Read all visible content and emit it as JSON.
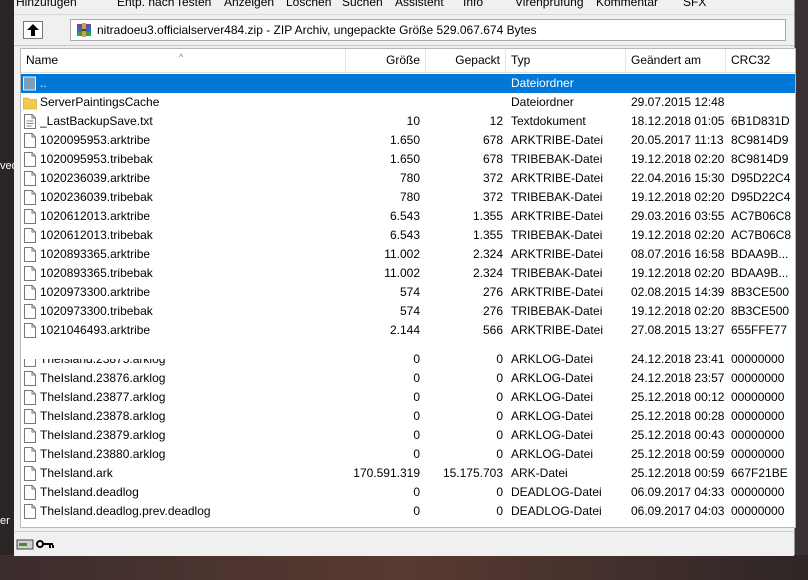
{
  "desktop": {
    "left_text_1": "ved",
    "left_text_2": "er"
  },
  "toolbar": {
    "items": [
      "Hinzufügen",
      "Entp. nach",
      "Testen",
      "Anzeigen",
      "Löschen",
      "Suchen",
      "Assistent",
      "Info",
      "Virenprüfung",
      "Kommentar",
      "SFX"
    ]
  },
  "address": {
    "text": "nitradoeu3.officialserver484.zip - ZIP Archiv, ungepackte Größe 529.067.674 Bytes"
  },
  "columns": {
    "name": "Name",
    "size": "Größe",
    "packed": "Gepackt",
    "type": "Typ",
    "modified": "Geändert am",
    "crc": "CRC32"
  },
  "files": [
    {
      "name": "..",
      "size": "",
      "packed": "",
      "type": "Dateiordner",
      "modified": "",
      "crc": "",
      "icon": "folder-up-icon"
    },
    {
      "name": "ServerPaintingsCache",
      "size": "",
      "packed": "",
      "type": "Dateiordner",
      "modified": "29.07.2015 12:48",
      "crc": "",
      "icon": "folder-icon"
    },
    {
      "name": "_LastBackupSave.txt",
      "size": "10",
      "packed": "12",
      "type": "Textdokument",
      "modified": "18.12.2018 01:05",
      "crc": "6B1D831D",
      "icon": "text-file-icon"
    },
    {
      "name": "1020095953.arktribe",
      "size": "1.650",
      "packed": "678",
      "type": "ARKTRIBE-Datei",
      "modified": "20.05.2017 11:13",
      "crc": "8C9814D9",
      "icon": "file-icon"
    },
    {
      "name": "1020095953.tribebak",
      "size": "1.650",
      "packed": "678",
      "type": "TRIBEBAK-Datei",
      "modified": "19.12.2018 02:20",
      "crc": "8C9814D9",
      "icon": "file-icon"
    },
    {
      "name": "1020236039.arktribe",
      "size": "780",
      "packed": "372",
      "type": "ARKTRIBE-Datei",
      "modified": "22.04.2016 15:30",
      "crc": "D95D22C4",
      "icon": "file-icon"
    },
    {
      "name": "1020236039.tribebak",
      "size": "780",
      "packed": "372",
      "type": "TRIBEBAK-Datei",
      "modified": "19.12.2018 02:20",
      "crc": "D95D22C4",
      "icon": "file-icon"
    },
    {
      "name": "1020612013.arktribe",
      "size": "6.543",
      "packed": "1.355",
      "type": "ARKTRIBE-Datei",
      "modified": "29.03.2016 03:55",
      "crc": "AC7B06C8",
      "icon": "file-icon"
    },
    {
      "name": "1020612013.tribebak",
      "size": "6.543",
      "packed": "1.355",
      "type": "TRIBEBAK-Datei",
      "modified": "19.12.2018 02:20",
      "crc": "AC7B06C8",
      "icon": "file-icon"
    },
    {
      "name": "1020893365.arktribe",
      "size": "11.002",
      "packed": "2.324",
      "type": "ARKTRIBE-Datei",
      "modified": "08.07.2016 16:58",
      "crc": "BDAA9B...",
      "icon": "file-icon"
    },
    {
      "name": "1020893365.tribebak",
      "size": "11.002",
      "packed": "2.324",
      "type": "TRIBEBAK-Datei",
      "modified": "19.12.2018 02:20",
      "crc": "BDAA9B...",
      "icon": "file-icon"
    },
    {
      "name": "1020973300.arktribe",
      "size": "574",
      "packed": "276",
      "type": "ARKTRIBE-Datei",
      "modified": "02.08.2015 14:39",
      "crc": "8B3CE500",
      "icon": "file-icon"
    },
    {
      "name": "1020973300.tribebak",
      "size": "574",
      "packed": "276",
      "type": "TRIBEBAK-Datei",
      "modified": "19.12.2018 02:20",
      "crc": "8B3CE500",
      "icon": "file-icon"
    },
    {
      "name": "1021046493.arktribe",
      "size": "2.144",
      "packed": "566",
      "type": "ARKTRIBE-Datei",
      "modified": "27.08.2015 13:27",
      "crc": "655FFE77",
      "icon": "file-icon"
    },
    {
      "name": "TheIsland.23875.arklog",
      "size": "0",
      "packed": "0",
      "type": "ARKLOG-Datei",
      "modified": "24.12.2018 23:41",
      "crc": "00000000",
      "icon": "file-icon"
    },
    {
      "name": "TheIsland.23876.arklog",
      "size": "0",
      "packed": "0",
      "type": "ARKLOG-Datei",
      "modified": "24.12.2018 23:57",
      "crc": "00000000",
      "icon": "file-icon"
    },
    {
      "name": "TheIsland.23877.arklog",
      "size": "0",
      "packed": "0",
      "type": "ARKLOG-Datei",
      "modified": "25.12.2018 00:12",
      "crc": "00000000",
      "icon": "file-icon"
    },
    {
      "name": "TheIsland.23878.arklog",
      "size": "0",
      "packed": "0",
      "type": "ARKLOG-Datei",
      "modified": "25.12.2018 00:28",
      "crc": "00000000",
      "icon": "file-icon"
    },
    {
      "name": "TheIsland.23879.arklog",
      "size": "0",
      "packed": "0",
      "type": "ARKLOG-Datei",
      "modified": "25.12.2018 00:43",
      "crc": "00000000",
      "icon": "file-icon"
    },
    {
      "name": "TheIsland.23880.arklog",
      "size": "0",
      "packed": "0",
      "type": "ARKLOG-Datei",
      "modified": "25.12.2018 00:59",
      "crc": "00000000",
      "icon": "file-icon"
    },
    {
      "name": "TheIsland.ark",
      "size": "170.591.319",
      "packed": "15.175.703",
      "type": "ARK-Datei",
      "modified": "25.12.2018 00:59",
      "crc": "667F21BE",
      "icon": "file-icon"
    },
    {
      "name": "TheIsland.deadlog",
      "size": "0",
      "packed": "0",
      "type": "DEADLOG-Datei",
      "modified": "06.09.2017 04:33",
      "crc": "00000000",
      "icon": "file-icon"
    },
    {
      "name": "TheIsland.deadlog.prev.deadlog",
      "size": "0",
      "packed": "0",
      "type": "DEADLOG-Datei",
      "modified": "06.09.2017 04:03",
      "crc": "00000000",
      "icon": "file-icon"
    }
  ],
  "colors": {
    "selection": "#0078d7",
    "folder": "#f3c94a"
  }
}
